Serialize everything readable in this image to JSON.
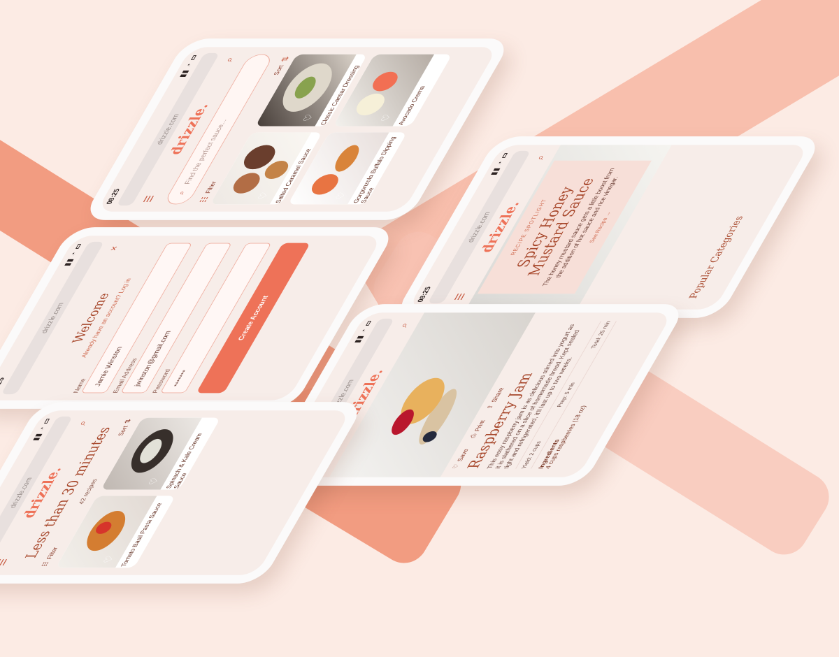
{
  "theme": {
    "brand": "#ee7258",
    "accent": "#c6563d",
    "background": "#fcebe4",
    "phone_shell": "#fbfafa"
  },
  "common": {
    "time": "08:25",
    "url": "drizzle.com",
    "logo": "drizzle."
  },
  "phones": {
    "browse": {
      "sort": "Sort",
      "filter": "Filter",
      "search_placeholder": "Find the perfect sauce...",
      "cards": [
        {
          "label": "Salted Caramel Sauce"
        },
        {
          "label": "Classic Caesar Dressing"
        },
        {
          "label": "Gorgonzola Buffalo Dipping Sauce"
        },
        {
          "label": "Avocado Crema"
        }
      ]
    },
    "signup": {
      "title": "Welcome",
      "login_prompt": "Already have an account? Log in",
      "labels": {
        "name": "Name",
        "email": "Email Address",
        "password": "Password"
      },
      "values": {
        "name": "Jamie Winston",
        "email": "jwinston@gmail.com",
        "password": "*******"
      },
      "button": "Create Account"
    },
    "spotlight": {
      "kicker": "RECIPE SPOTLIGHT",
      "title": "Spicy Honey Mustard Sauce",
      "description": "The honey mustard sauce gets a little boost from the addition of hot sauce and rice vinegar.",
      "link": "See Recipe →",
      "section": "Popular Categories"
    },
    "recipe": {
      "actions": {
        "save": "Save",
        "print": "Print",
        "share": "Share"
      },
      "title": "Raspberry Jam",
      "description": "This easy raspberry jam is as delicious stirred into yogurt as it is slathered on a slice of homemade bread. Kept sealed tight and refrigerated, it'll last up to two weeks.",
      "meta": {
        "yield": "Yield: 2 cups",
        "prep": "Prep: 5 min",
        "total": "Total: 25 min"
      },
      "ingredients_title": "Ingredients",
      "ingredient_first": "4 cups raspberries (18 oz)"
    },
    "list": {
      "title": "Less than 30 minutes",
      "filter": "Filter",
      "sort": "Sort",
      "count": "42 recipes",
      "cards": [
        {
          "label": "Tomato Basil Pasta Sauce"
        },
        {
          "label": "Spinach & Kale Cream Sauce"
        }
      ]
    }
  },
  "icons": {
    "menu": "menu-icon",
    "search": "search-icon",
    "heart": "heart-icon",
    "close": "close-icon",
    "filter": "filter-icon",
    "sort": "sort-icon",
    "print": "print-icon",
    "share": "share-icon"
  }
}
